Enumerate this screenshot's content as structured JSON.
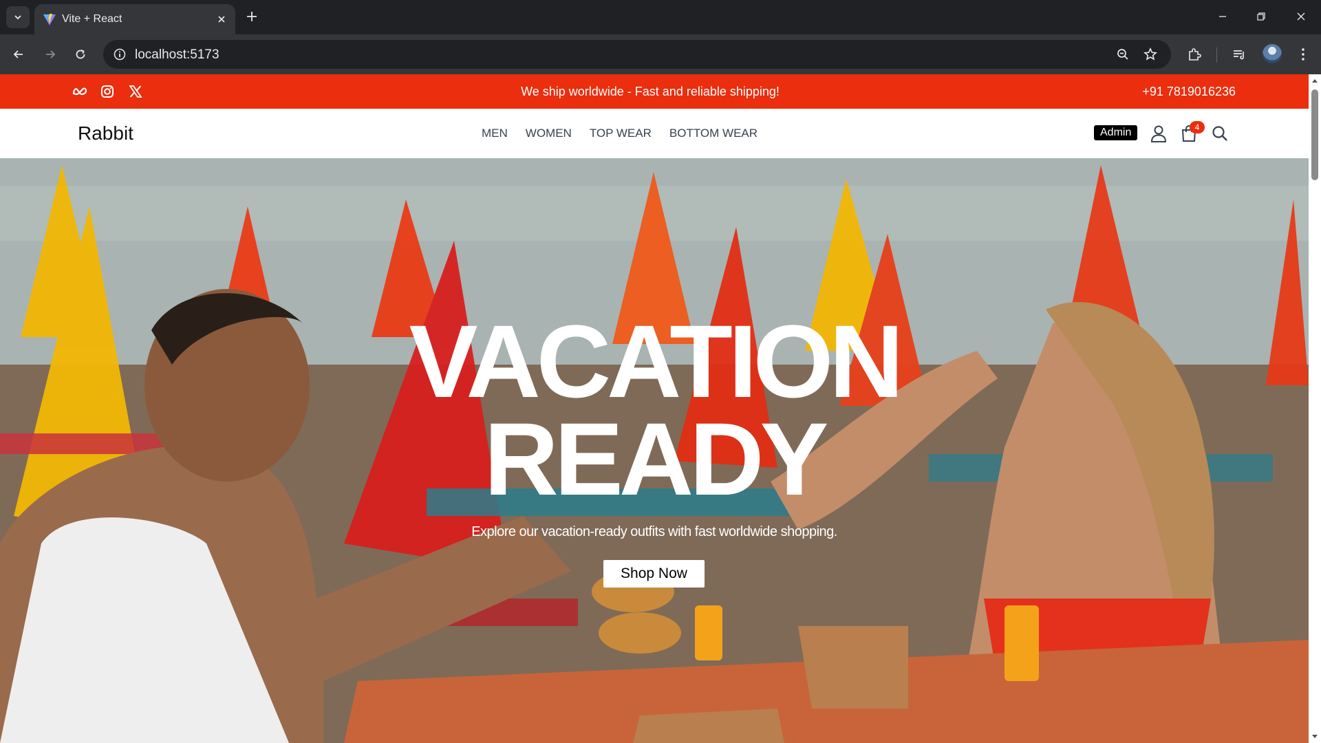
{
  "browser": {
    "tab_title": "Vite + React",
    "url": "localhost:5173"
  },
  "topbar": {
    "icons": [
      "meta-icon",
      "instagram-icon",
      "x-icon"
    ],
    "message": "We ship worldwide - Fast and reliable shipping!",
    "phone": "+91 7819016236",
    "background": "#ea2e0e"
  },
  "navbar": {
    "logo": "Rabbit",
    "links": [
      "MEN",
      "WOMEN",
      "TOP WEAR",
      "BOTTOM WEAR"
    ],
    "admin_label": "Admin",
    "cart_count": "4"
  },
  "hero": {
    "title_line1": "VACATION",
    "title_line2": "READY",
    "subtitle": "Explore our vacation-ready outfits with fast worldwide shopping.",
    "cta": "Shop Now"
  }
}
